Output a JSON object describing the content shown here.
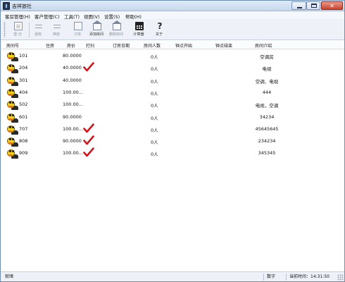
{
  "window": {
    "title": "吉祥旅社",
    "controls": {
      "minimize_icon": "minimize-icon",
      "maximize_icon": "maximize-icon",
      "close_glyph": "✕"
    }
  },
  "menubar": {
    "items": [
      "客房管理(H)",
      "客户管理(C)",
      "工具(T)",
      "视图(V)",
      "设置(S)",
      "帮助(H)"
    ]
  },
  "toolbar": {
    "buttons": [
      {
        "label": "登 记",
        "icon": "register-icon",
        "enabled": false
      },
      {
        "label": "退房",
        "icon": "checkout-icon",
        "enabled": true
      },
      {
        "label": "换房",
        "icon": "change-room-icon",
        "enabled": true
      },
      {
        "label": "订房",
        "icon": "booking-card-icon",
        "enabled": true
      },
      {
        "label": "添加房间",
        "icon": "add-room-house-icon",
        "enabled": true
      },
      {
        "label": "删除房间",
        "icon": "delete-room-house-icon",
        "enabled": true
      },
      {
        "label": "计算器",
        "icon": "calculator-icon",
        "enabled": true
      },
      {
        "label": "关于",
        "icon": "about-question-icon",
        "enabled": true
      }
    ]
  },
  "table": {
    "columns": [
      "房间号",
      "住房",
      "房价",
      "打扫",
      "订房日期",
      "房间人数",
      "钟点开始",
      "钟点结束",
      "房间介绍"
    ],
    "rows": [
      {
        "room": "101",
        "price": "80.0000",
        "cleaned": false,
        "count": "0人",
        "intro": "空调房"
      },
      {
        "room": "204",
        "price": "40.0000",
        "cleaned": true,
        "count": "0人",
        "intro": "电视"
      },
      {
        "room": "301",
        "price": "40.0000",
        "cleaned": false,
        "count": "0人",
        "intro": "空调、电视"
      },
      {
        "room": "404",
        "price": "100.00...",
        "cleaned": false,
        "count": "0人",
        "intro": "444"
      },
      {
        "room": "502",
        "price": "100.00...",
        "cleaned": false,
        "count": "0人",
        "intro": "电视，空调"
      },
      {
        "room": "601",
        "price": "90.0000",
        "cleaned": false,
        "count": "0人",
        "intro": "34234"
      },
      {
        "room": "707",
        "price": "100.00...",
        "cleaned": true,
        "count": "0人",
        "intro": "45645645"
      },
      {
        "room": "808",
        "price": "90.0000",
        "cleaned": true,
        "count": "0人",
        "intro": "234234"
      },
      {
        "room": "909",
        "price": "100.00...",
        "cleaned": true,
        "count": "0人",
        "intro": "345345"
      }
    ],
    "row_icon": "guest-avatar-icon",
    "check_icon": "cleaned-checkmark-icon",
    "check_color": "#d0161b"
  },
  "statusbar": {
    "ready": "就绪",
    "mode": "数字",
    "time": "当前时间：14:31:50"
  }
}
